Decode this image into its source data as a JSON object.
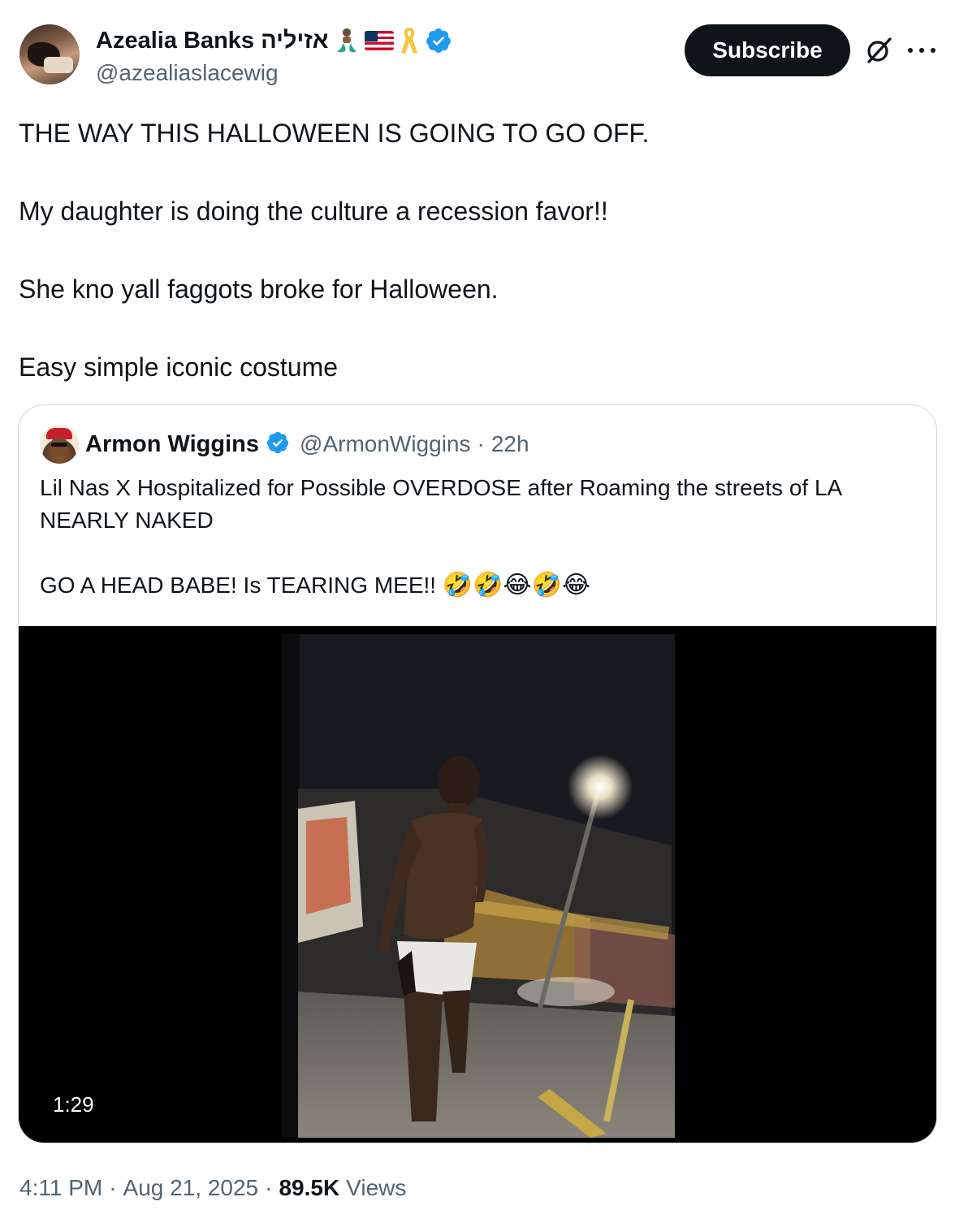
{
  "author": {
    "display_name": "Azealia Banks אזיליה",
    "handle": "@azealiaslacewig",
    "avatar": "avatar-photo",
    "badges": [
      "mermaid-emoji",
      "us-flag-emoji",
      "yellow-ribbon-emoji",
      "verified-badge-icon"
    ]
  },
  "header_actions": {
    "subscribe_label": "Subscribe",
    "grok_icon": "grok-icon",
    "more_icon": "more-icon"
  },
  "tweet": {
    "paragraphs": [
      "THE WAY THIS HALLOWEEN IS GOING TO GO OFF.",
      "My daughter is doing the culture a recession favor!!",
      "She kno yall faggots broke for Halloween.",
      "Easy simple iconic costume"
    ]
  },
  "quote": {
    "display_name": "Armon Wiggins",
    "handle": "@ArmonWiggins",
    "separator": "·",
    "time": "22h",
    "paragraphs": [
      "Lil Nas X Hospitalized for Possible OVERDOSE after Roaming the streets of LA NEARLY NAKED",
      "GO A HEAD BABE! Is TEARING MEE!!"
    ],
    "emojis": "🤣🤣😂🤣😂",
    "video": {
      "duration": "1:29"
    }
  },
  "meta": {
    "time": "4:11 PM",
    "sep1": "·",
    "date": "Aug 21, 2025",
    "sep2": "·",
    "views_count": "89.5K",
    "views_label": "Views"
  },
  "colors": {
    "text_primary": "#0f1419",
    "text_secondary": "#536471",
    "verified_blue": "#1d9bf0",
    "border": "#cfd9de",
    "subscribe_bg": "#0f1419"
  }
}
